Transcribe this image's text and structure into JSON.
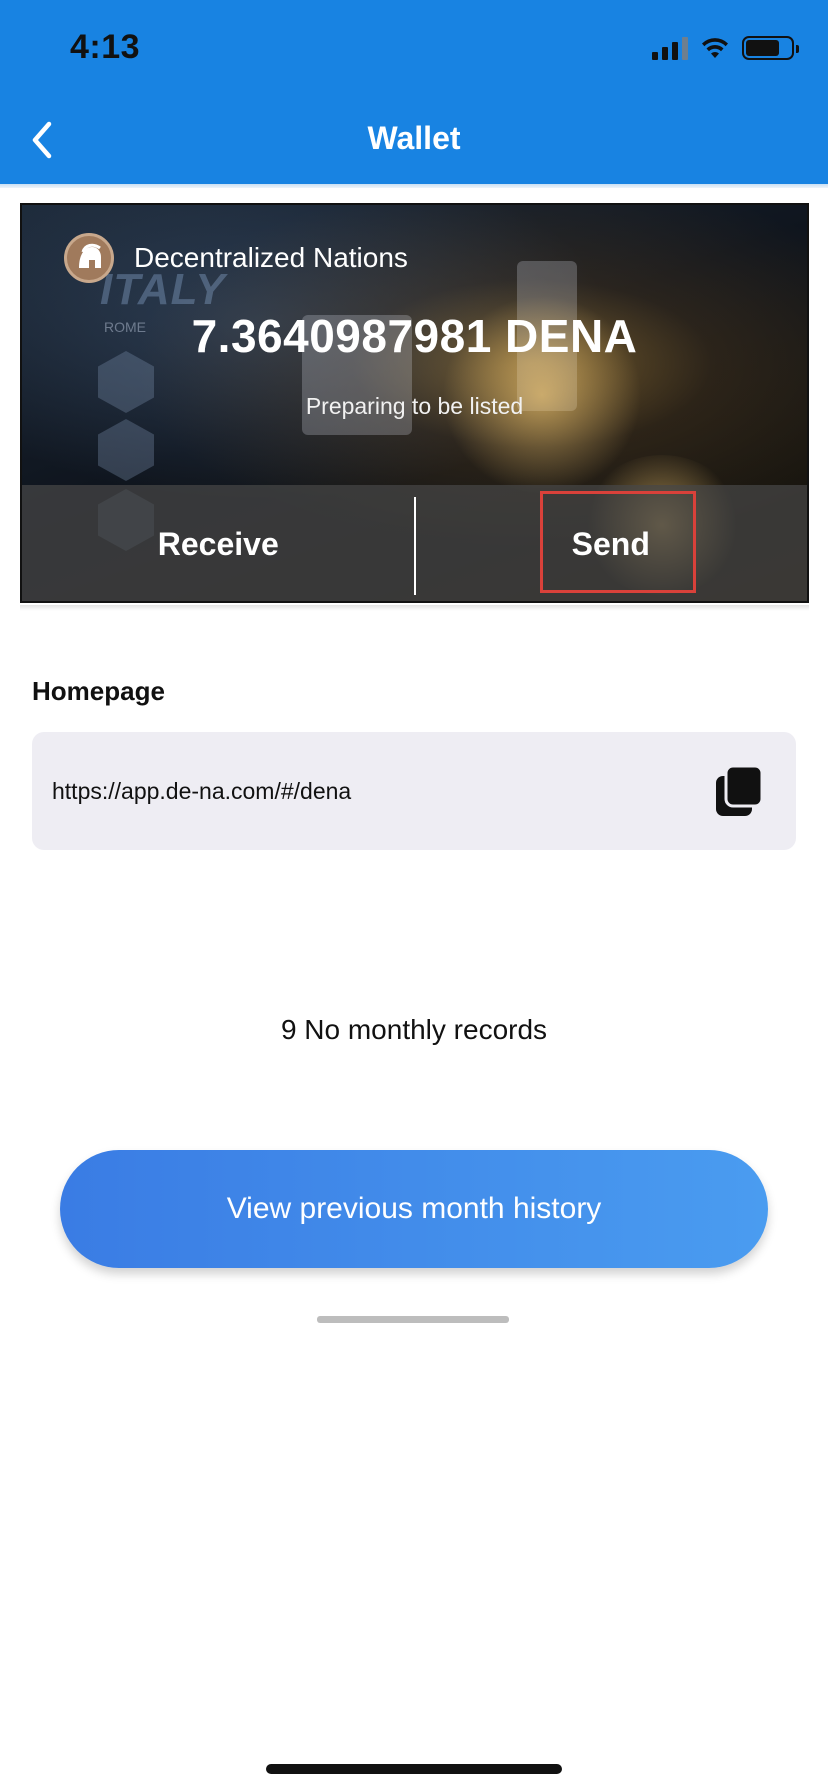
{
  "status_bar": {
    "time": "4:13"
  },
  "nav": {
    "title": "Wallet"
  },
  "card": {
    "coin_name": "Decentralized Nations",
    "balance": "7.3640987981 DENA",
    "listing_status": "Preparing to be listed",
    "receive_label": "Receive",
    "send_label": "Send",
    "background_text": "ITALY",
    "background_subtext": "ROME"
  },
  "homepage": {
    "label": "Homepage",
    "url": "https://app.de-na.com/#/dena"
  },
  "records": {
    "empty_text": "9 No monthly records"
  },
  "history_button": {
    "label": "View previous month history"
  },
  "colors": {
    "header_bg": "#1883e2",
    "button_gradient_start": "#3a7ce4",
    "button_gradient_end": "#4a9cf0",
    "highlight": "#d9413a"
  },
  "icons": {
    "back": "chevron-left-icon",
    "signal": "signal-icon",
    "wifi": "wifi-icon",
    "battery": "battery-icon",
    "copy": "copy-icon",
    "coin_logo": "spartan-helmet-icon"
  }
}
